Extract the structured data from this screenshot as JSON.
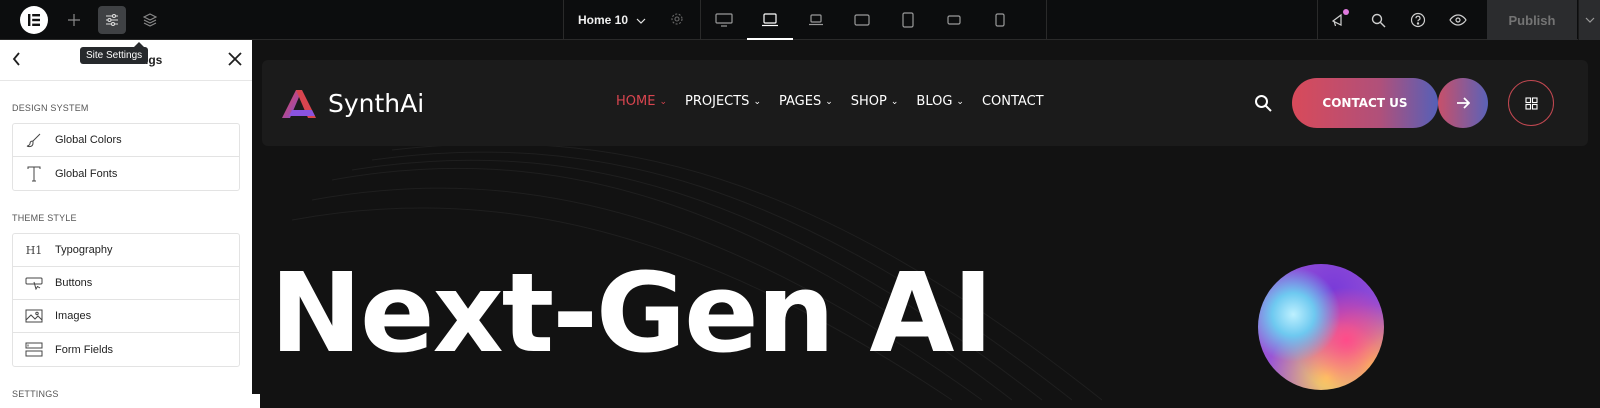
{
  "topbar": {
    "logo_icon": "elementor-logo-icon",
    "add_icon": "plus-icon",
    "settings_icon": "sliders-icon",
    "layers_icon": "layers-icon",
    "tooltip": "Site Settings",
    "page_name": "Home 10",
    "devices": [
      "desktop",
      "laptop-wide",
      "laptop",
      "tablet-landscape",
      "tablet",
      "mobile-landscape",
      "mobile"
    ],
    "active_device": "laptop-wide",
    "publish_label": "Publish"
  },
  "panel": {
    "title": "Site Settings",
    "sections": [
      {
        "title": "Design System",
        "items": [
          {
            "label": "Global Colors",
            "icon": "brush-icon"
          },
          {
            "label": "Global Fonts",
            "icon": "font-icon"
          }
        ]
      },
      {
        "title": "Theme Style",
        "items": [
          {
            "label": "Typography",
            "icon": "heading-icon",
            "glyph": "H1"
          },
          {
            "label": "Buttons",
            "icon": "button-icon"
          },
          {
            "label": "Images",
            "icon": "image-icon"
          },
          {
            "label": "Form Fields",
            "icon": "form-icon"
          }
        ]
      },
      {
        "title": "Settings"
      }
    ]
  },
  "site": {
    "brand": "SynthAi",
    "nav": [
      {
        "label": "HOME",
        "caret": "⌄"
      },
      {
        "label": "PROJECTS",
        "caret": "⌄"
      },
      {
        "label": "PAGES",
        "caret": "⌄"
      },
      {
        "label": "SHOP",
        "caret": "⌄"
      },
      {
        "label": "BLOG",
        "caret": "⌄"
      },
      {
        "label": "CONTACT",
        "caret": ""
      }
    ],
    "active_nav": "HOME",
    "cta_label": "CONTACT US",
    "hero_title": "Next-Gen AI",
    "colors": {
      "accent": "#d8454f",
      "cta_gradient_start": "#d84a5a",
      "cta_gradient_end": "#5560b8",
      "background": "#121212"
    }
  }
}
